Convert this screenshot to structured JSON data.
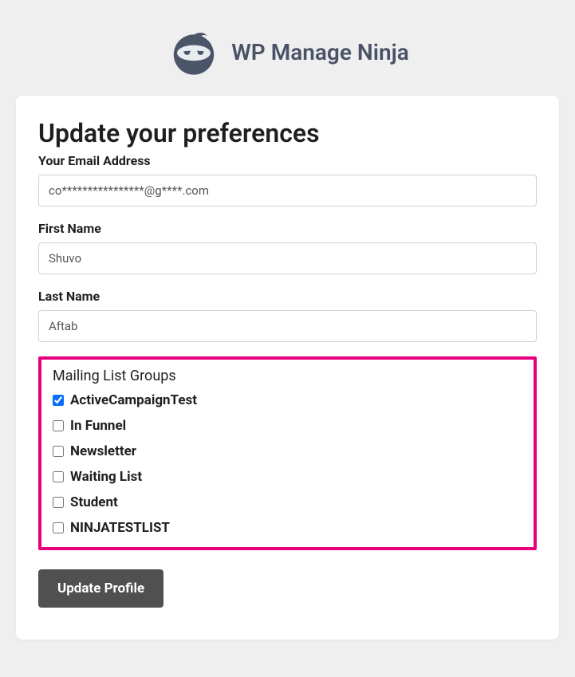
{
  "header": {
    "brand": "WP Manage Ninja"
  },
  "form": {
    "title": "Update your preferences",
    "email": {
      "label": "Your Email Address",
      "value": "co****************@g****.com"
    },
    "first_name": {
      "label": "First Name",
      "value": "Shuvo"
    },
    "last_name": {
      "label": "Last Name",
      "value": "Aftab"
    },
    "groups": {
      "title": "Mailing List Groups",
      "items": [
        {
          "label": "ActiveCampaignTest",
          "checked": true
        },
        {
          "label": "In Funnel",
          "checked": false
        },
        {
          "label": "Newsletter",
          "checked": false
        },
        {
          "label": "Waiting List",
          "checked": false
        },
        {
          "label": "Student",
          "checked": false
        },
        {
          "label": "NINJATESTLIST",
          "checked": false
        }
      ]
    },
    "submit_label": "Update Profile"
  }
}
